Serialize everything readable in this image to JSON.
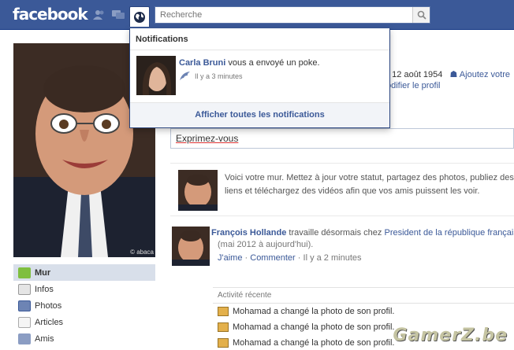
{
  "topbar": {
    "logo": "facebook",
    "search_placeholder": "Recherche",
    "icons": [
      "friends-icon",
      "messages-icon",
      "notifications-globe-icon",
      "search-icon"
    ]
  },
  "notifications": {
    "header": "Notifications",
    "entries": [
      {
        "sender": "Carla Bruni",
        "message": "vous a envoyé un poke.",
        "time": "Il y a 3 minutes",
        "icon": "poke-icon"
      }
    ],
    "footer": "Afficher toutes les notifications"
  },
  "profile": {
    "photo_tag": "pure",
    "photo_credit": "© abaca",
    "info_date": "e 12 août 1954",
    "add_link": "Ajoutez votre",
    "edit_link": "odifier le profil"
  },
  "leftnav": {
    "items": [
      {
        "label": "Mur",
        "icon": "wall-icon",
        "selected": true
      },
      {
        "label": "Infos",
        "icon": "info-icon",
        "selected": false
      },
      {
        "label": "Photos",
        "icon": "photos-icon",
        "selected": false
      },
      {
        "label": "Articles",
        "icon": "notes-icon",
        "selected": false
      },
      {
        "label": "Amis",
        "icon": "friends-icon",
        "selected": false
      }
    ]
  },
  "composer": {
    "placeholder": "Exprimez-vous"
  },
  "wall_intro": {
    "text": "Voici votre mur. Mettez à jour votre statut, partagez des photos, publiez des liens et téléchargez des vidéos afin que vos amis puissent les voir."
  },
  "story": {
    "name": "François Hollande",
    "verb": "travaille désormais chez",
    "employer": "President de la république française",
    "period": "(mai 2012 à aujourd'hui).",
    "like": "J'aime",
    "comment": "Commenter",
    "separator": "·",
    "time": "Il y a 2 minutes"
  },
  "recent_activity": {
    "title": "Activité récente",
    "rows": [
      "Mohamad a changé la photo de son profil.",
      "Mohamad a changé la photo de son profil.",
      "Mohamad a changé la photo de son profil."
    ]
  },
  "watermark": "GamerZ.be",
  "colors": {
    "brand": "#3b5998",
    "brand_dark": "#29447e",
    "nav_selected": "#d8dfea"
  }
}
